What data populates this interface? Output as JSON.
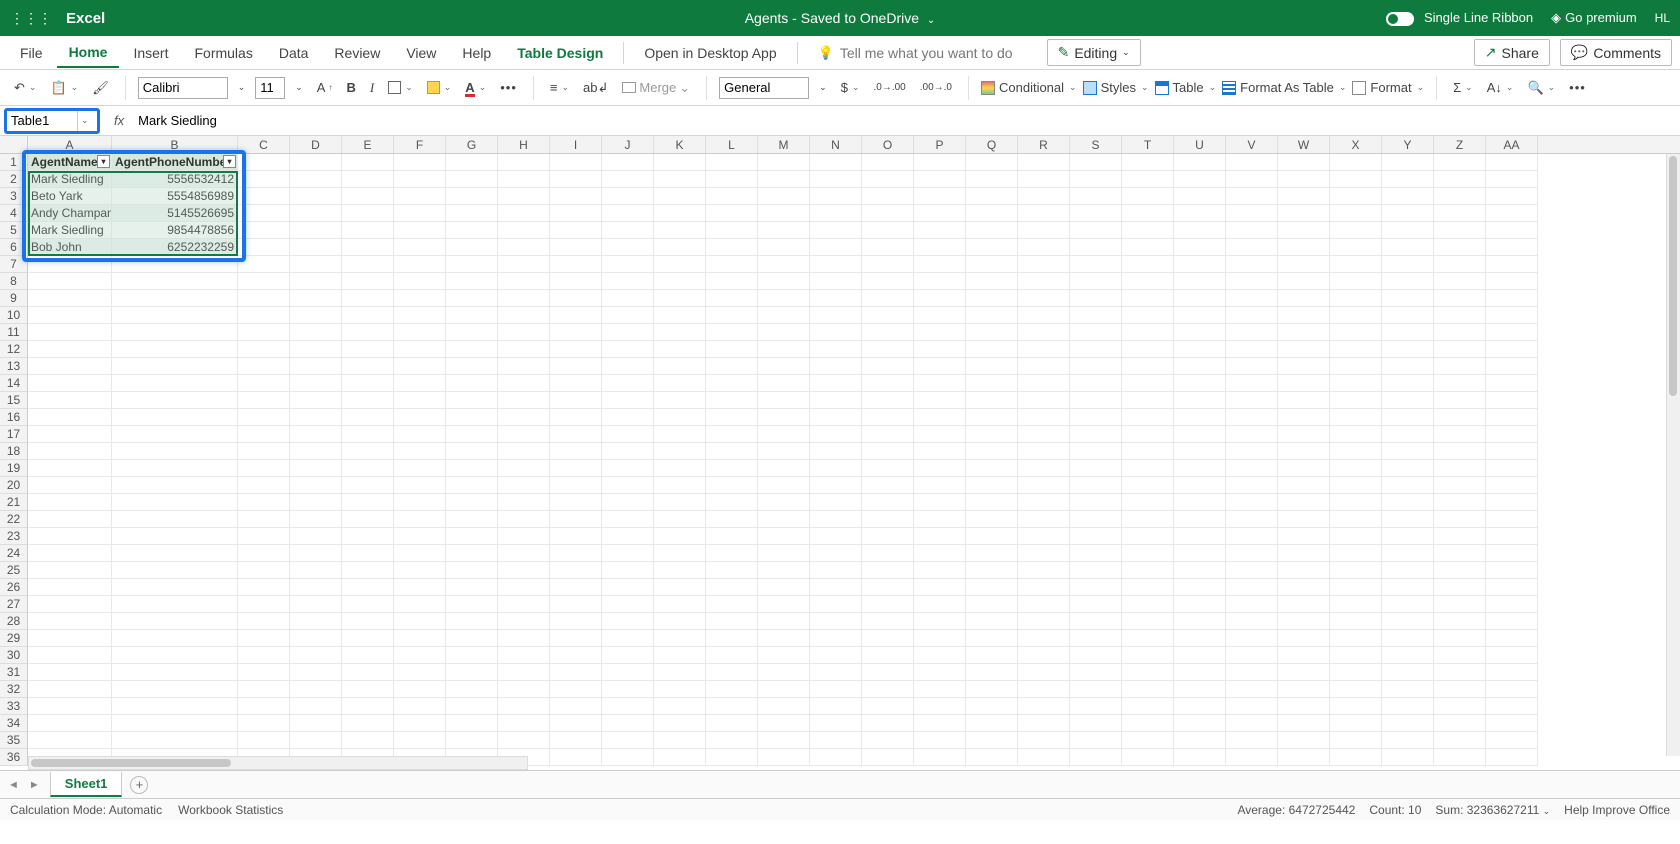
{
  "titlebar": {
    "app_name": "Excel",
    "doc_title": "Agents - Saved to OneDrive",
    "single_line_ribbon": "Single Line Ribbon",
    "go_premium": "Go premium",
    "user_initials": "HL"
  },
  "tabs": {
    "file": "File",
    "home": "Home",
    "insert": "Insert",
    "formulas": "Formulas",
    "data": "Data",
    "review": "Review",
    "view": "View",
    "help": "Help",
    "table_design": "Table Design",
    "open_desktop": "Open in Desktop App",
    "tell_me": "Tell me what you want to do",
    "editing": "Editing",
    "share": "Share",
    "comments": "Comments"
  },
  "ribbon": {
    "font_name": "Calibri",
    "font_size": "11",
    "merge": "Merge",
    "number_format": "General",
    "conditional": "Conditional",
    "styles": "Styles",
    "table": "Table",
    "format_as_table": "Format As Table",
    "format": "Format"
  },
  "formula_bar": {
    "name_box": "Table1",
    "formula": "Mark Siedling"
  },
  "columns": [
    "A",
    "B",
    "C",
    "D",
    "E",
    "F",
    "G",
    "H",
    "I",
    "J",
    "K",
    "L",
    "M",
    "N",
    "O",
    "P",
    "Q",
    "R",
    "S",
    "T",
    "U",
    "V",
    "W",
    "X",
    "Y",
    "Z",
    "AA"
  ],
  "table": {
    "headers": {
      "a": "AgentName",
      "b": "AgentPhoneNumber"
    },
    "rows": [
      {
        "a": "Mark Siedling",
        "b": "5556532412"
      },
      {
        "a": "Beto Yark",
        "b": "5554856989"
      },
      {
        "a": "Andy Champan",
        "b": "5145526695"
      },
      {
        "a": "Mark Siedling",
        "b": "9854478856"
      },
      {
        "a": "Bob John",
        "b": "6252232259"
      }
    ]
  },
  "sheet": {
    "name": "Sheet1"
  },
  "status": {
    "calc_mode": "Calculation Mode: Automatic",
    "wb_stats": "Workbook Statistics",
    "average": "Average: 6472725442",
    "count": "Count: 10",
    "sum": "Sum: 32363627211",
    "help_improve": "Help Improve Office"
  }
}
